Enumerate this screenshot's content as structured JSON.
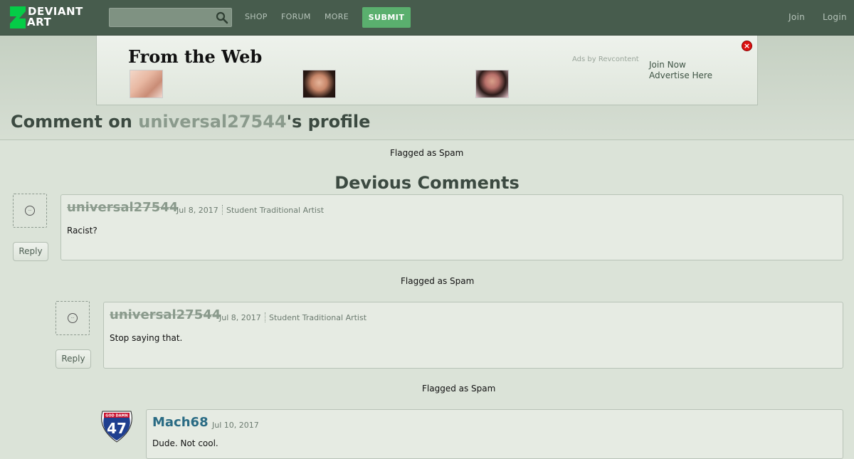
{
  "header": {
    "logo_line1": "DEVIANT",
    "logo_line2": "ART",
    "search_placeholder": "",
    "nav": [
      "SHOP",
      "FORUM",
      "MORE"
    ],
    "submit_label": "SUBMIT",
    "join_label": "Join",
    "login_label": "Login"
  },
  "ad": {
    "title": "From the Web",
    "attribution": "Ads by Revcontent",
    "join_now": "Join Now",
    "advertise": "Advertise Here",
    "close_icon": "close-icon"
  },
  "page": {
    "title_prefix": "Comment on ",
    "title_user": "universal27544",
    "title_suffix": "'s profile"
  },
  "flags": [
    "Flagged as Spam",
    "Flagged as Spam",
    "Flagged as Spam"
  ],
  "section_title": "Devious Comments",
  "comments": [
    {
      "author": "universal27544",
      "date": "Jul 8, 2017",
      "role": "Student Traditional Artist",
      "body": "Racist?",
      "reply_label": "Reply"
    },
    {
      "author": "universal27544",
      "date": "Jul 8, 2017",
      "role": "Student Traditional Artist",
      "body": "Stop saying that.",
      "reply_label": "Reply"
    },
    {
      "author": "Mach68",
      "date": "Jul 10, 2017",
      "role": "",
      "body": "Dude. Not cool.",
      "badge_top": "GOD DAMN",
      "badge_number": "47"
    }
  ],
  "colors": {
    "header_bg": "#475c4d",
    "submit_bg": "#5aaf6e",
    "page_bg": "#dbe3d8",
    "link": "#2a6b84",
    "logo_green": "#05cc47"
  }
}
